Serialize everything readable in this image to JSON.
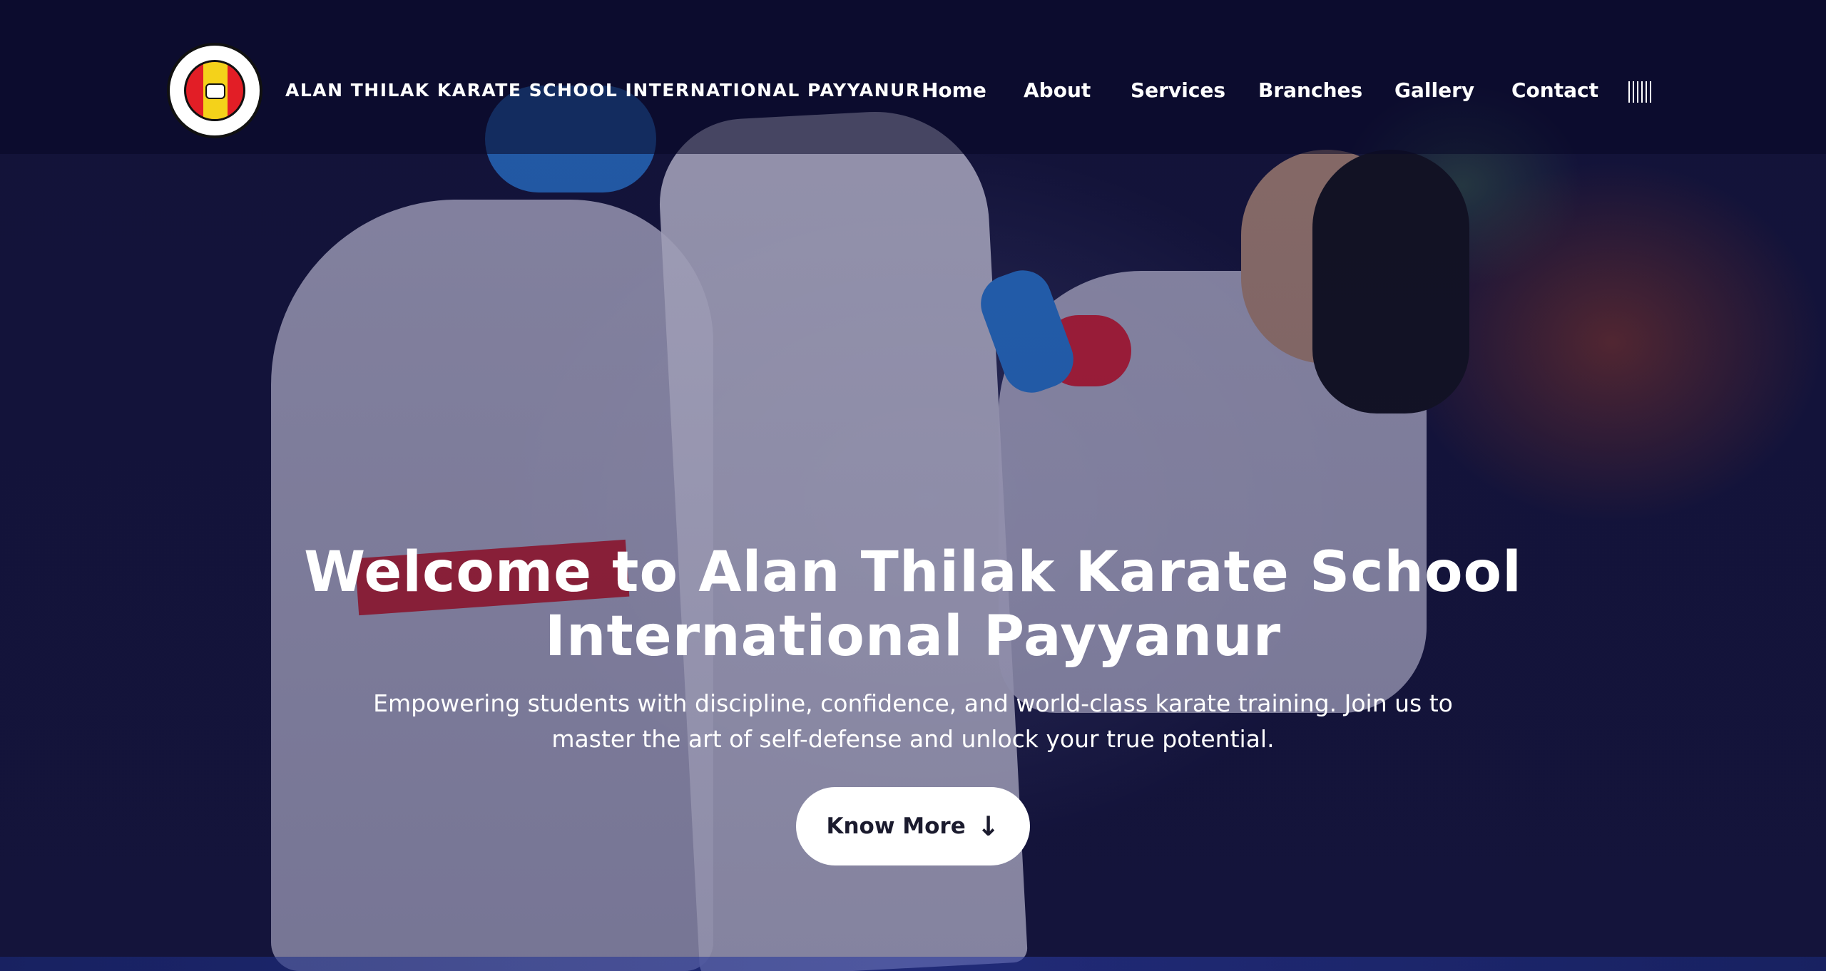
{
  "brand": {
    "name": "ALAN THILAK KARATE SCHOOL INTERNATIONAL PAYYANUR",
    "logo_icon": "karate-school-emblem"
  },
  "nav": {
    "items": [
      {
        "label": "Home"
      },
      {
        "label": "About"
      },
      {
        "label": "Services"
      },
      {
        "label": "Branches"
      },
      {
        "label": "Gallery"
      },
      {
        "label": "Contact"
      }
    ],
    "menu_icon": "menu-bars-icon"
  },
  "hero": {
    "headline": "Welcome to Alan Thilak Karate School International Payyanur",
    "subtext": "Empowering students with discipline, confidence, and world-class karate training. Join us to master the art of self-defense and unlock your true potential.",
    "cta_label": "Know More",
    "cta_icon": "arrow-down-icon"
  },
  "colors": {
    "overlay": "#16163d",
    "logo_red": "#e21e26",
    "logo_yellow": "#f4d21a",
    "button_bg": "#ffffff",
    "text": "#ffffff"
  }
}
